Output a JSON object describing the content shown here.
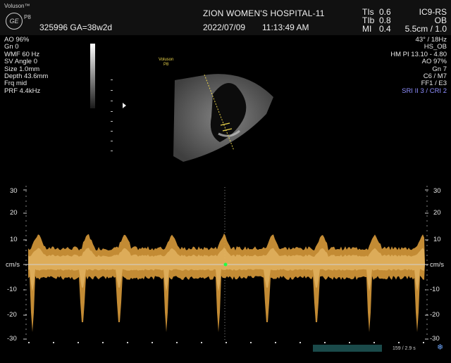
{
  "header": {
    "brand": "Voluson™",
    "logo": "GE",
    "probe": "P8",
    "hospital": "ZION WOMEN'S HOSPITAL-11",
    "patient": "325996  GA=38w2d",
    "date": "2022/07/09",
    "time": "11:13:49 AM",
    "indices": [
      {
        "label": "TIs",
        "value": "0.6"
      },
      {
        "label": "TIb",
        "value": "0.8"
      },
      {
        "label": "MI",
        "value": "0.4"
      }
    ],
    "probe_model": "IC9-RS",
    "app": "OB",
    "depth": "5.5cm / 1.0"
  },
  "left_params": [
    "AO 96%",
    "Gn  0",
    "WMF 60 Hz",
    "SV Angle  0",
    "Size  1.0mm",
    "Depth 43.6mm",
    "Frq mid",
    "PRF  4.4kHz"
  ],
  "right_params": [
    "43° / 18Hz",
    "HS_OB",
    "HM PI 13.10 - 4.80",
    "AO 97%",
    "Gn  7",
    "C6 / M7",
    "FF1 / E3"
  ],
  "right_params_highlight": "SRI II 3 / CRI 2",
  "doppler_label": [
    "Voluson",
    "P8"
  ],
  "axis": {
    "labels_left": [
      "30",
      "20",
      "10",
      "cm/s",
      "-10",
      "-20",
      "-30"
    ],
    "labels_right": [
      "30",
      "20",
      "10",
      "cm/s",
      "-10",
      "-20",
      "-30"
    ]
  },
  "footer": {
    "frames": "159 / 2.9 s"
  },
  "colors": {
    "doppler": "#e0a040",
    "highlight": "#8f8fff",
    "marker": "#22ff44"
  }
}
